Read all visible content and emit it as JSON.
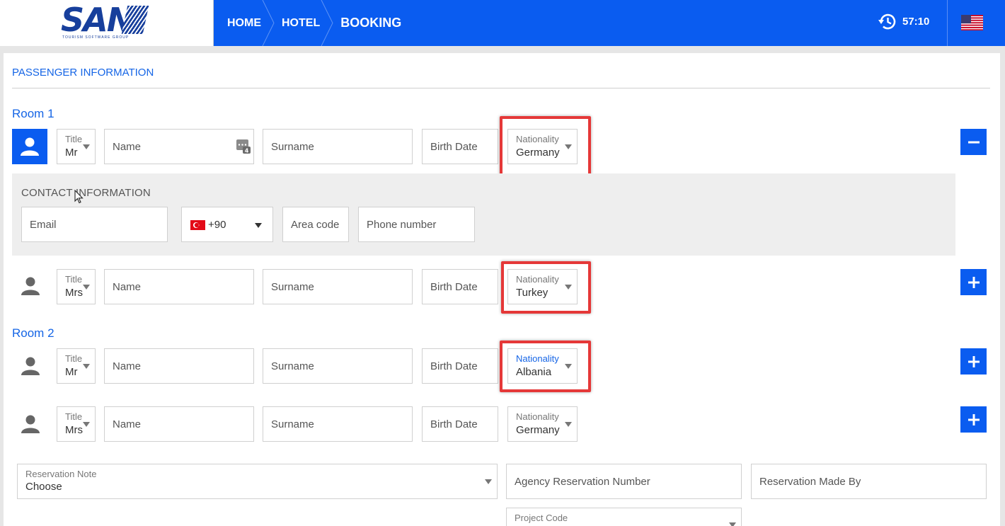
{
  "header": {
    "logo_text": "SAN",
    "logo_sub": "TOURISM SOFTWARE GROUP",
    "breadcrumbs": [
      "HOME",
      "HOTEL",
      "BOOKING"
    ],
    "timer": "57:10",
    "language_flag": "us-flag-icon"
  },
  "section_title": "PASSENGER INFORMATION",
  "rooms": [
    {
      "title": "Room 1",
      "passengers": [
        {
          "title_label": "Title",
          "title_value": "Mr",
          "name_ph": "Name",
          "surname_ph": "Surname",
          "birth_ph": "Birth Date",
          "nat_label": "Nationality",
          "nat_value": "Germany",
          "action": "−"
        },
        {
          "title_label": "Title",
          "title_value": "Mrs",
          "name_ph": "Name",
          "surname_ph": "Surname",
          "birth_ph": "Birth Date",
          "nat_label": "Nationality",
          "nat_value": "Turkey",
          "action": "+"
        }
      ]
    },
    {
      "title": "Room 2",
      "passengers": [
        {
          "title_label": "Title",
          "title_value": "Mr",
          "name_ph": "Name",
          "surname_ph": "Surname",
          "birth_ph": "Birth Date",
          "nat_label": "Nationality",
          "nat_value": "Albania",
          "action": "+"
        },
        {
          "title_label": "Title",
          "title_value": "Mrs",
          "name_ph": "Name",
          "surname_ph": "Surname",
          "birth_ph": "Birth Date",
          "nat_label": "Nationality",
          "nat_value": "Germany",
          "action": "+"
        }
      ]
    }
  ],
  "contact": {
    "title": "CONTACT INFORMATION",
    "email_ph": "Email",
    "dial_code": "+90",
    "area_ph": "Area code",
    "phone_ph": "Phone number"
  },
  "reservation": {
    "note_label": "Reservation Note",
    "note_value": "Choose",
    "agency_ph": "Agency Reservation Number",
    "made_by_ph": "Reservation Made By",
    "project_label": "Project Code"
  },
  "colors": {
    "primary": "#0a5cf0",
    "accent_text": "#1565e6",
    "highlight": "#e53838"
  }
}
